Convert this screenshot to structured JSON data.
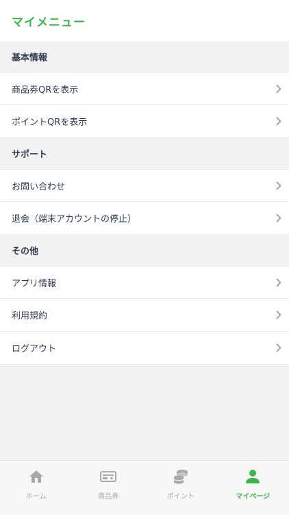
{
  "header": {
    "title": "マイメニュー"
  },
  "sections": [
    {
      "title": "基本情報",
      "items": [
        {
          "label": "商品券QRを表示"
        },
        {
          "label": "ポイントQRを表示"
        }
      ]
    },
    {
      "title": "サポート",
      "items": [
        {
          "label": "お問い合わせ"
        },
        {
          "label": "退会（端末アカウントの停止）"
        }
      ]
    },
    {
      "title": "その他",
      "items": [
        {
          "label": "アプリ情報"
        },
        {
          "label": "利用規約"
        },
        {
          "label": "ログアウト"
        }
      ]
    }
  ],
  "tabbar": {
    "tabs": [
      {
        "label": "ホーム",
        "icon": "home-icon",
        "active": false
      },
      {
        "label": "商品券",
        "icon": "voucher-icon",
        "active": false
      },
      {
        "label": "ポイント",
        "icon": "coins-icon",
        "active": false
      },
      {
        "label": "マイページ",
        "icon": "person-icon",
        "active": true
      }
    ]
  },
  "colors": {
    "accent": "#3cb54b",
    "inactive": "#a9a9a9",
    "text": "#2e3a4d"
  }
}
